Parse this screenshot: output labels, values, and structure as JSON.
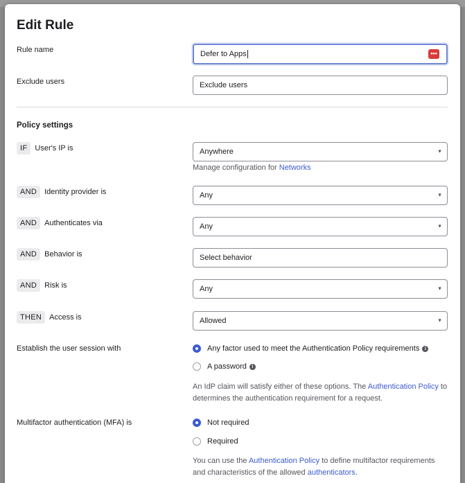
{
  "modal": {
    "title": "Edit Rule"
  },
  "rule_name": {
    "label": "Rule name",
    "value": "Defer to Apps"
  },
  "exclude_users": {
    "label": "Exclude users",
    "placeholder": "Exclude users"
  },
  "policy": {
    "section_title": "Policy settings",
    "if_ip": {
      "tag": "IF",
      "label": "User's IP is",
      "value": "Anywhere"
    },
    "networks_help": {
      "prefix": "Manage configuration for ",
      "link": "Networks"
    },
    "idp": {
      "tag": "AND",
      "label": "Identity provider is",
      "value": "Any"
    },
    "authn": {
      "tag": "AND",
      "label": "Authenticates via",
      "value": "Any"
    },
    "behavior": {
      "tag": "AND",
      "label": "Behavior is",
      "placeholder": "Select behavior"
    },
    "risk": {
      "tag": "AND",
      "label": "Risk is",
      "value": "Any"
    },
    "access": {
      "tag": "THEN",
      "label": "Access is",
      "value": "Allowed"
    }
  },
  "session": {
    "label": "Establish the user session with",
    "option1": "Any factor used to meet the Authentication Policy requirements",
    "option2": "A password",
    "help_prefix": "An IdP claim will satisfy either of these options. The ",
    "help_link": "Authentication Policy",
    "help_suffix": " to",
    "help_line2": "determines the authentication requirement for a request."
  },
  "mfa": {
    "label": "Multifactor authentication (MFA) is",
    "option1": "Not required",
    "option2": "Required",
    "help_prefix": "You can use the ",
    "help_link": "Authentication Policy",
    "help_middle": " to define multifactor requirements",
    "help_line2_prefix": "and characteristics of the allowed ",
    "help_link2": "authenticators",
    "help_line2_suffix": "."
  },
  "colors": {
    "accent": "#3c5bcf",
    "focus": "#6e86d6",
    "password_manager": "#d93b3b"
  },
  "icons": {
    "dropdown": "chevron-down-icon",
    "info": "info-icon",
    "password_manager": "password-manager-icon"
  }
}
